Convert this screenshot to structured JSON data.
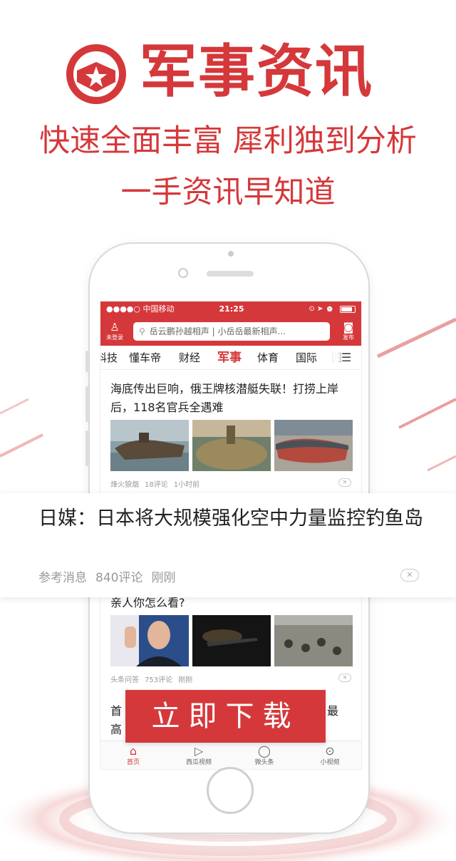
{
  "brand": {
    "title": "军事资讯",
    "slogan_line1": "快速全面丰富 犀利独到分析",
    "slogan_line2": "一手资讯早知道",
    "accent_color": "#d5383a",
    "logo_icon": "star-shield-icon"
  },
  "status_bar": {
    "carrier": "●●●●○ 中国移动",
    "time": "21:25",
    "icons": "⊙ ➤ ⏰"
  },
  "app_bar": {
    "user_label": "未登录",
    "search_placeholder": "岳云鹏孙越相声 | 小岳岳最新相声...",
    "publish_label": "发布"
  },
  "tabs": [
    {
      "label": "科技"
    },
    {
      "label": "懂车帝"
    },
    {
      "label": "财经"
    },
    {
      "label": "军事",
      "active": true
    },
    {
      "label": "体育"
    },
    {
      "label": "国际"
    },
    {
      "label": "图"
    }
  ],
  "feed": {
    "article1": {
      "title": "海底传出巨响，俄王牌核潜艇失联！打捞上岸后，118名官兵全遇难",
      "source": "烽火狼烟",
      "comments": "18评论",
      "time": "1小时前"
    },
    "article3": {
      "title": "亲人你怎么看?",
      "source": "头条问答",
      "comments": "753评论",
      "time": "刚刚"
    },
    "article4": {
      "line1_left": "首",
      "line1_right": "最",
      "line2_left": "高"
    }
  },
  "overlay_card": {
    "title": "日媒：日本将大规模强化空中力量监控钓鱼岛",
    "source": "参考消息",
    "comments": "840评论",
    "time": "刚刚"
  },
  "tab_bar": [
    {
      "label": "首页",
      "icon": "home-icon",
      "active": true
    },
    {
      "label": "西瓜视频",
      "icon": "play-icon"
    },
    {
      "label": "微头条",
      "icon": "chat-bubble-icon"
    },
    {
      "label": "小视频",
      "icon": "small-video-icon"
    }
  ],
  "cta": {
    "label": "立即下载"
  }
}
